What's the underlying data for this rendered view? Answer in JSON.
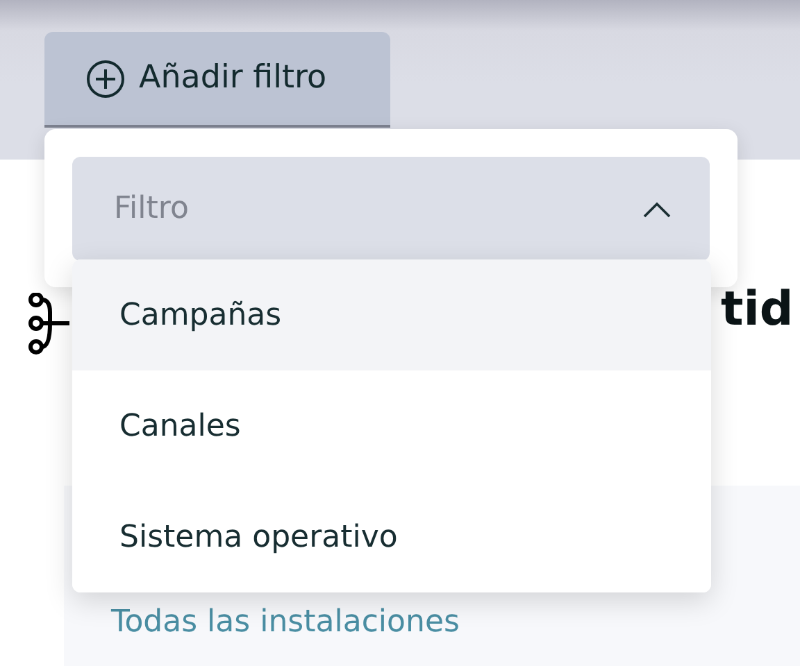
{
  "toolbar": {
    "add_filter_button": {
      "label": "Añadir filtro"
    }
  },
  "filter_popover": {
    "select": {
      "placeholder": "Filtro",
      "expanded": true
    },
    "options": [
      {
        "label": "Campañas",
        "selected": true
      },
      {
        "label": "Canales",
        "selected": false
      },
      {
        "label": "Sistema operativo",
        "selected": false
      }
    ]
  },
  "page": {
    "heading": "tid",
    "link": "Todas las instalaciones"
  }
}
